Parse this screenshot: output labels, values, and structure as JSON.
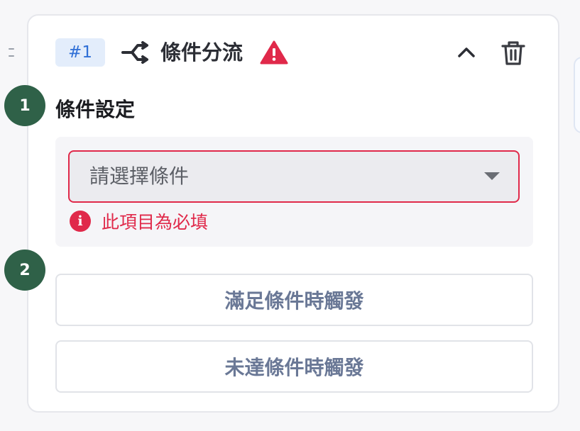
{
  "header": {
    "id_badge": "#1",
    "title": "條件分流",
    "icons": [
      "flow-branch-icon",
      "warning-icon",
      "chevron-up-icon",
      "trash-icon"
    ]
  },
  "steps": [
    "1",
    "2"
  ],
  "condition": {
    "section_title": "條件設定",
    "select_placeholder": "請選擇條件",
    "error_message": "此項目為必填",
    "error_icon_glyph": "i"
  },
  "triggers": {
    "met_label": "滿足條件時觸發",
    "unmet_label": "未達條件時觸發"
  },
  "colors": {
    "accent_blue": "#2f6fd6",
    "error_red": "#e0294a",
    "step_green": "#2f6148",
    "button_text": "#6a7896"
  }
}
